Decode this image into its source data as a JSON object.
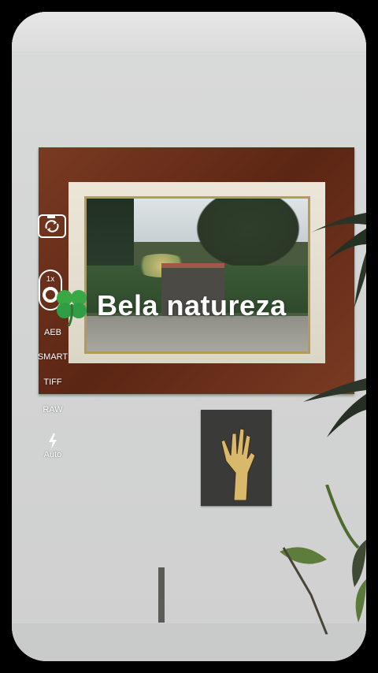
{
  "overlay": {
    "sticker_title": "Bela natureza",
    "sticker_icon": "four-leaf-clover-icon"
  },
  "controls": {
    "camera_switch_icon": "camera-switch-icon",
    "zoom_label": "1x",
    "shutter_mode_icon": "ring-icon",
    "modes": [
      "AEB",
      "SMART",
      "TIFF",
      "RAW"
    ],
    "flash_icon": "lightning-bolt-icon",
    "flash_label": "Auto"
  },
  "colors": {
    "overlay_text": "#ffffff",
    "clover_green": "#2f9e44"
  }
}
